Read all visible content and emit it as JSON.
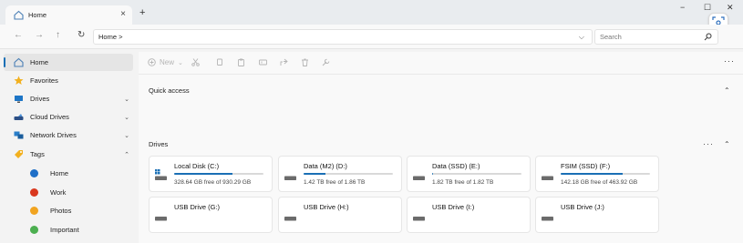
{
  "tab": {
    "title": "Home",
    "close": "×",
    "new": "+"
  },
  "window": {
    "minimize": "−",
    "maximize": "☐",
    "close": "✕"
  },
  "nav": {
    "back": "←",
    "forward": "→",
    "up": "↑",
    "refresh": "↻"
  },
  "address": {
    "path": "Home  >",
    "dropdown": "⌵"
  },
  "search": {
    "placeholder": "Search"
  },
  "sidebar": {
    "items": [
      {
        "label": "Home",
        "icon": "home-icon"
      },
      {
        "label": "Favorites",
        "icon": "star-icon"
      },
      {
        "label": "Drives",
        "icon": "monitor-icon",
        "chevron": "⌄"
      },
      {
        "label": "Cloud Drives",
        "icon": "cloud-drive-icon",
        "chevron": "⌄"
      },
      {
        "label": "Network Drives",
        "icon": "network-icon",
        "chevron": "⌄"
      },
      {
        "label": "Tags",
        "icon": "tag-icon",
        "chevron": "⌃"
      }
    ],
    "tags": [
      {
        "label": "Home",
        "color": "#1f6fc7"
      },
      {
        "label": "Work",
        "color": "#d9381e"
      },
      {
        "label": "Photos",
        "color": "#f1a420"
      },
      {
        "label": "Important",
        "color": "#4caf50"
      }
    ]
  },
  "toolbar": {
    "new_label": "New",
    "new_chevron": "⌄",
    "more": "···"
  },
  "sections": {
    "quick_access": {
      "title": "Quick access",
      "chevron": "⌃"
    },
    "drives": {
      "title": "Drives",
      "more": "···",
      "chevron": "⌃"
    }
  },
  "drives": [
    {
      "name": "Local Disk (C:)",
      "free": "328.64 GB free of 930.29 GB",
      "used_fraction": 0.65
    },
    {
      "name": "Data (M2) (D:)",
      "free": "1.42 TB free of 1.86 TB",
      "used_fraction": 0.24
    },
    {
      "name": "Data (SSD) (E:)",
      "free": "1.82 TB free of 1.82 TB",
      "used_fraction": 0.01
    },
    {
      "name": "FSIM (SSD) (F:)",
      "free": "142.18 GB free of 463.92 GB",
      "used_fraction": 0.69
    },
    {
      "name": "USB Drive (G:)"
    },
    {
      "name": "USB Drive (H:)"
    },
    {
      "name": "USB Drive (I:)"
    },
    {
      "name": "USB Drive (J:)"
    }
  ],
  "colors": {
    "accent": "#1a6fb5"
  }
}
